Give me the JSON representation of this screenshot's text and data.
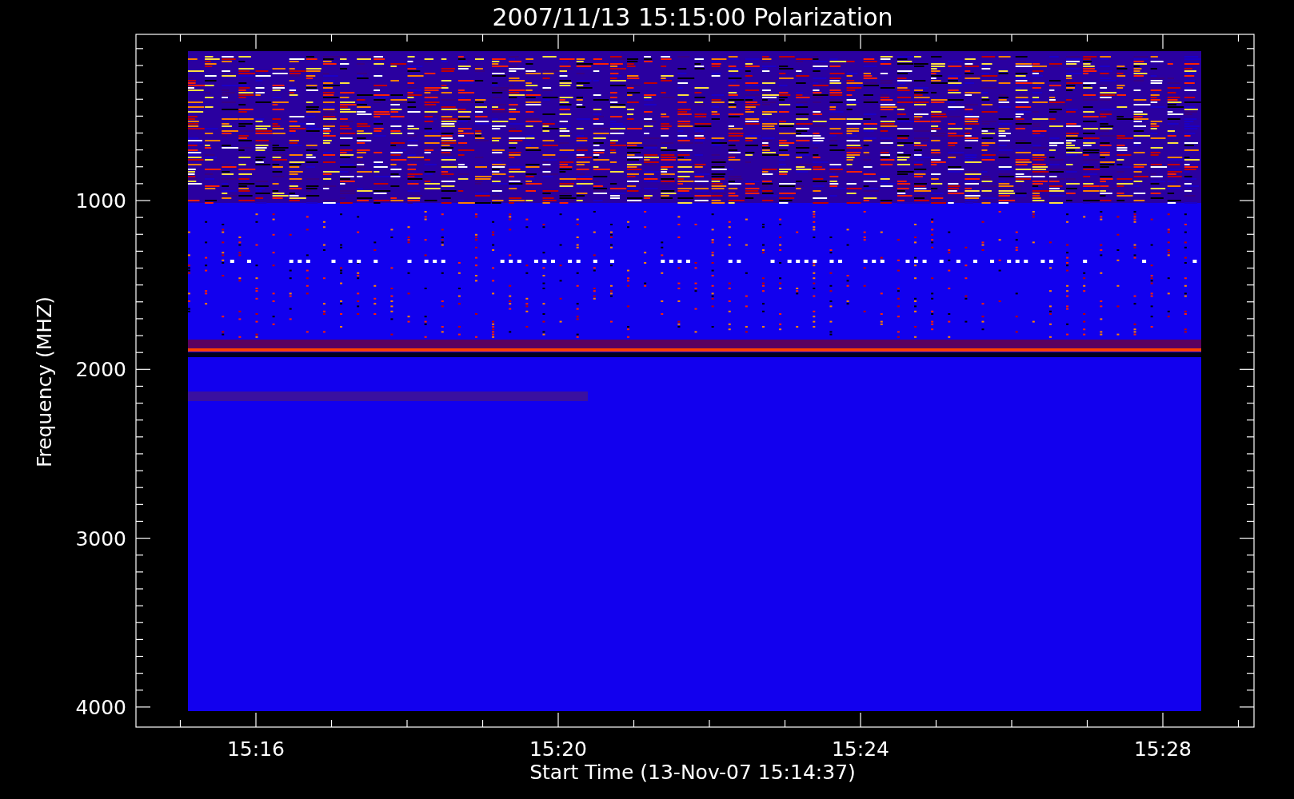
{
  "title": "2007/11/13 15:15:00 Polarization",
  "y_axis": {
    "label": "Frequency (MHZ)",
    "ticks": [
      "1000",
      "2000",
      "3000",
      "4000"
    ]
  },
  "x_axis": {
    "label": "Start Time (13-Nov-07 15:14:37)",
    "ticks": [
      "15:16",
      "15:20",
      "15:24",
      "15:28"
    ]
  }
}
